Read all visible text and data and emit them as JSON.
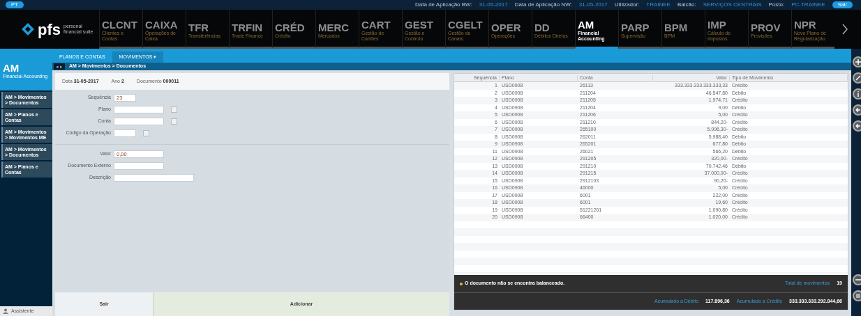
{
  "status_bar": {
    "menu_button": "PT",
    "items": [
      {
        "label": "Data de Aplicação BW:",
        "value": "31-05-2017"
      },
      {
        "label": "Data de Aplicação NW:",
        "value": "31-05-2017"
      },
      {
        "label": "Utilizador:",
        "value": "TRAINEE"
      },
      {
        "label": "Balcão:",
        "value": "SERVIÇOS CENTRAIS"
      },
      {
        "label": "Posto:",
        "value": "PC-TRAINEE"
      }
    ],
    "logout": "Sair"
  },
  "logo": {
    "name": "pfs",
    "tagline": "personal financial suite"
  },
  "modules": [
    {
      "code": "CLCNT",
      "subtitle": "Clientes e Contas",
      "selected": false
    },
    {
      "code": "CAIXA",
      "subtitle": "Operações de Caixa",
      "selected": false
    },
    {
      "code": "TFR",
      "subtitle": "Transferências",
      "selected": false
    },
    {
      "code": "TRFIN",
      "subtitle": "Trade Finance",
      "selected": false
    },
    {
      "code": "CRÉD",
      "subtitle": "Crédito",
      "selected": false
    },
    {
      "code": "MERC",
      "subtitle": "Mercados",
      "selected": false
    },
    {
      "code": "CART",
      "subtitle": "Gestão de Cartões",
      "selected": false
    },
    {
      "code": "GEST",
      "subtitle": "Gestão e Controlo",
      "selected": false
    },
    {
      "code": "CGELT",
      "subtitle": "Gestão de Canais",
      "selected": false
    },
    {
      "code": "OPER",
      "subtitle": "Operações",
      "selected": false
    },
    {
      "code": "DD",
      "subtitle": "Débitos Diretos",
      "selected": false
    },
    {
      "code": "AM",
      "subtitle": "Financial Accounting",
      "selected": true
    },
    {
      "code": "PARP",
      "subtitle": "Supervisão",
      "selected": false
    },
    {
      "code": "BPM",
      "subtitle": "BPM",
      "selected": false
    },
    {
      "code": "IMP",
      "subtitle": "Cálculo de Impostos",
      "selected": false
    },
    {
      "code": "PROV",
      "subtitle": "Provisões",
      "selected": false
    },
    {
      "code": "NPR",
      "subtitle": "Novo Plano de Regularização",
      "selected": false
    }
  ],
  "module_panel": {
    "code": "AM",
    "subtitle": "Financial Accounting"
  },
  "subtabs": [
    {
      "label": "PLANOS E CONTAS",
      "selected": false
    },
    {
      "label": "MOVIMENTOS ▾",
      "selected": true
    }
  ],
  "breadcrumb": {
    "back": "◂ ▸",
    "path": "AM > Movimentos > Documentos"
  },
  "sidebar": {
    "items": [
      {
        "label": "AM > Movimentos > Documentos"
      },
      {
        "label": "AM > Planos e Contas"
      },
      {
        "label": "AM > Movimentos > Movimentos ME"
      },
      {
        "label": "AM > Movimentos > Documentos"
      },
      {
        "label": "AM > Planos e Contas"
      }
    ],
    "assistant": "Assistente"
  },
  "form": {
    "header": [
      {
        "label": "Data",
        "value": "31-05-2017"
      },
      {
        "label": "Ano",
        "value": "2"
      },
      {
        "label": "Documento",
        "value": "000011"
      }
    ],
    "fields": [
      {
        "label": "Sequência",
        "value": "23",
        "lookup": false,
        "separated": false
      },
      {
        "label": "Plano",
        "lookup": true,
        "separated": false
      },
      {
        "label": "Conta",
        "lookup": true,
        "separated": false
      },
      {
        "label": "Código da Operação",
        "lookup": true,
        "separated": false
      },
      {
        "label": "Valor",
        "value": "0,00",
        "lookup": false,
        "separated": true
      },
      {
        "label": "Documento Externo",
        "lookup": false,
        "separated": false
      },
      {
        "label": "Descrição",
        "lookup": false,
        "separated": false
      }
    ],
    "buttons": [
      {
        "label": "Sair",
        "kind": "plain"
      },
      {
        "label": "Adicionar",
        "kind": "primary"
      }
    ]
  },
  "table": {
    "columns": [
      "Sequência",
      "Plano",
      "Conta",
      "Valor",
      "Tipo de Movimento"
    ],
    "rows": [
      [
        "1",
        "USD0908",
        "26113",
        "333.333.333.333.333,33",
        "Crédito"
      ],
      [
        "2",
        "USD0908",
        "211204",
        "46.547,80",
        "Débito"
      ],
      [
        "3",
        "USD0908",
        "211205",
        "1.974,71",
        "Crédito"
      ],
      [
        "4",
        "USD0908",
        "211204",
        "9,00",
        "Débito"
      ],
      [
        "5",
        "USD0908",
        "211206",
        "5,00",
        "Crédito"
      ],
      [
        "6",
        "USD0908",
        "211210",
        "844,20-",
        "Crédito"
      ],
      [
        "7",
        "USD0908",
        "265100",
        "5.996,30-",
        "Crédito"
      ],
      [
        "8",
        "USD0908",
        "262011",
        "5.988,40",
        "Débito"
      ],
      [
        "9",
        "USD0908",
        "265201",
        "677,80",
        "Débito"
      ],
      [
        "11",
        "USD0908",
        "26021",
        "566,20",
        "Débito"
      ],
      [
        "12",
        "USD0908",
        "291205",
        "320,00-",
        "Crédito"
      ],
      [
        "13",
        "USD0908",
        "291210",
        "70.742,46",
        "Débito"
      ],
      [
        "14",
        "USD0908",
        "291215",
        "37.000,00-",
        "Crédito"
      ],
      [
        "15",
        "USD0908",
        "2912103",
        "90,20-",
        "Crédito"
      ],
      [
        "16",
        "USD0908",
        "46000",
        "5,00",
        "Crédito"
      ],
      [
        "17",
        "USD0908",
        "6001",
        "222,00",
        "Crédito"
      ],
      [
        "18",
        "USD0908",
        "6001",
        "19,60",
        "Crédito"
      ],
      [
        "19",
        "USD0908",
        "51221201",
        "1.090,80",
        "Crédito"
      ],
      [
        "20",
        "USD0908",
        "66400",
        "1.020,00",
        "Crédito"
      ]
    ]
  },
  "summary": {
    "warning": "O documento não se encontra balanceado.",
    "total_label": "Total de movimentos",
    "total": "19",
    "debit_label": "Acumulado a Débito",
    "debit": "117.896,36",
    "credit_label": "Acumulado a Crédito",
    "credit": "333.333.333.292.844,66"
  },
  "rail": {
    "top_buttons": [
      {
        "kind": "add"
      },
      {
        "kind": "edit"
      },
      {
        "kind": "info"
      },
      {
        "kind": "back"
      },
      {
        "kind": "back"
      }
    ],
    "bottom_buttons": [
      {
        "kind": "minus"
      },
      {
        "kind": "list"
      }
    ]
  }
}
